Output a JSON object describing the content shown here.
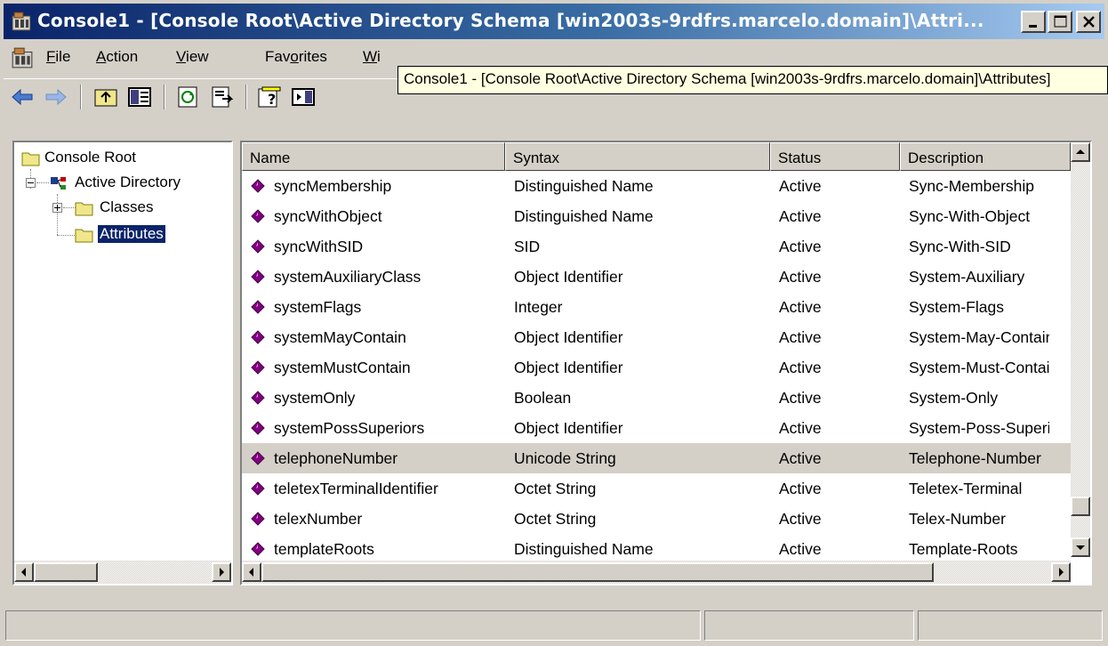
{
  "window": {
    "title": "Console1 - [Console Root\\Active Directory Schema [win2003s-9rdfrs.marcelo.domain]\\Attri..."
  },
  "menu": {
    "items": [
      {
        "pre": "",
        "u": "F",
        "post": "ile"
      },
      {
        "pre": "",
        "u": "A",
        "post": "ction"
      },
      {
        "pre": "",
        "u": "V",
        "post": "iew"
      },
      {
        "pre": "Fav",
        "u": "o",
        "post": "rites"
      },
      {
        "pre": "",
        "u": "W",
        "post": "i"
      }
    ]
  },
  "tooltip": {
    "text": "Console1 - [Console Root\\Active Directory Schema [win2003s-9rdfrs.marcelo.domain]\\Attributes]"
  },
  "tree": {
    "root": "Console Root",
    "schema": "Active Directory",
    "classes": "Classes",
    "attributes": "Attributes"
  },
  "list": {
    "columns": [
      "Name",
      "Syntax",
      "Status",
      "Description"
    ],
    "rows": [
      {
        "name": "syncMembership",
        "syntax": "Distinguished Name",
        "status": "Active",
        "description": "Sync-Membership"
      },
      {
        "name": "syncWithObject",
        "syntax": "Distinguished Name",
        "status": "Active",
        "description": "Sync-With-Object"
      },
      {
        "name": "syncWithSID",
        "syntax": "SID",
        "status": "Active",
        "description": "Sync-With-SID"
      },
      {
        "name": "systemAuxiliaryClass",
        "syntax": "Object Identifier",
        "status": "Active",
        "description": "System-Auxiliary"
      },
      {
        "name": "systemFlags",
        "syntax": "Integer",
        "status": "Active",
        "description": "System-Flags"
      },
      {
        "name": "systemMayContain",
        "syntax": "Object Identifier",
        "status": "Active",
        "description": "System-May-Contain"
      },
      {
        "name": "systemMustContain",
        "syntax": "Object Identifier",
        "status": "Active",
        "description": "System-Must-Contain"
      },
      {
        "name": "systemOnly",
        "syntax": "Boolean",
        "status": "Active",
        "description": "System-Only"
      },
      {
        "name": "systemPossSuperiors",
        "syntax": "Object Identifier",
        "status": "Active",
        "description": "System-Poss-Superiors"
      },
      {
        "name": "telephoneNumber",
        "syntax": "Unicode String",
        "status": "Active",
        "description": "Telephone-Number"
      },
      {
        "name": "teletexTerminalIdentifier",
        "syntax": "Octet String",
        "status": "Active",
        "description": "Teletex-Terminal"
      },
      {
        "name": "telexNumber",
        "syntax": "Octet String",
        "status": "Active",
        "description": "Telex-Number"
      },
      {
        "name": "templateRoots",
        "syntax": "Distinguished Name",
        "status": "Active",
        "description": "Template-Roots"
      }
    ],
    "highlighted_row": 9
  },
  "colors": {
    "title_active": "#0a246a",
    "face": "#d4d0c8",
    "attribute_icon": "#800080"
  }
}
